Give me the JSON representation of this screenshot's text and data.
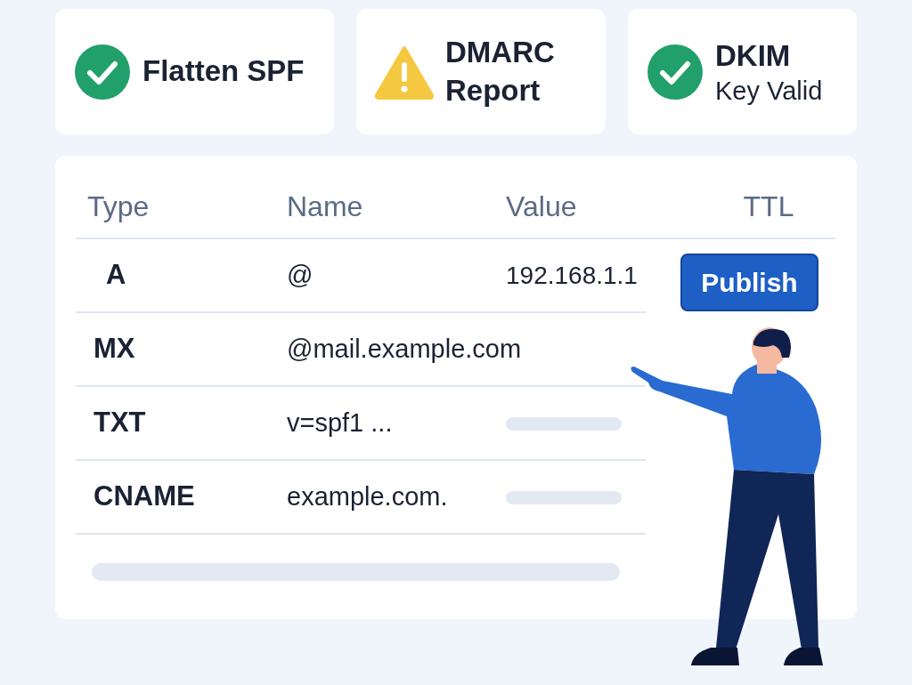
{
  "status_cards": [
    {
      "kind": "ok",
      "title": "Flatten SPF"
    },
    {
      "kind": "warning",
      "title": "DMARC Report"
    },
    {
      "kind": "ok",
      "title": "DKIM",
      "subtitle": "Key Valid"
    }
  ],
  "table": {
    "columns": [
      "Type",
      "Name",
      "Value",
      "TTL"
    ],
    "rows": [
      {
        "type": "A",
        "name": "@",
        "value": "192.168.1.1",
        "value_bar": false
      },
      {
        "type": "MX",
        "name": "@mail.example.com",
        "value_bar": false
      },
      {
        "type": "TXT",
        "name": "v=spf1 ...",
        "value_bar": true
      },
      {
        "type": "CNAME",
        "name": "example.com.",
        "value_bar": true
      }
    ]
  },
  "publish_button": "Publish"
}
